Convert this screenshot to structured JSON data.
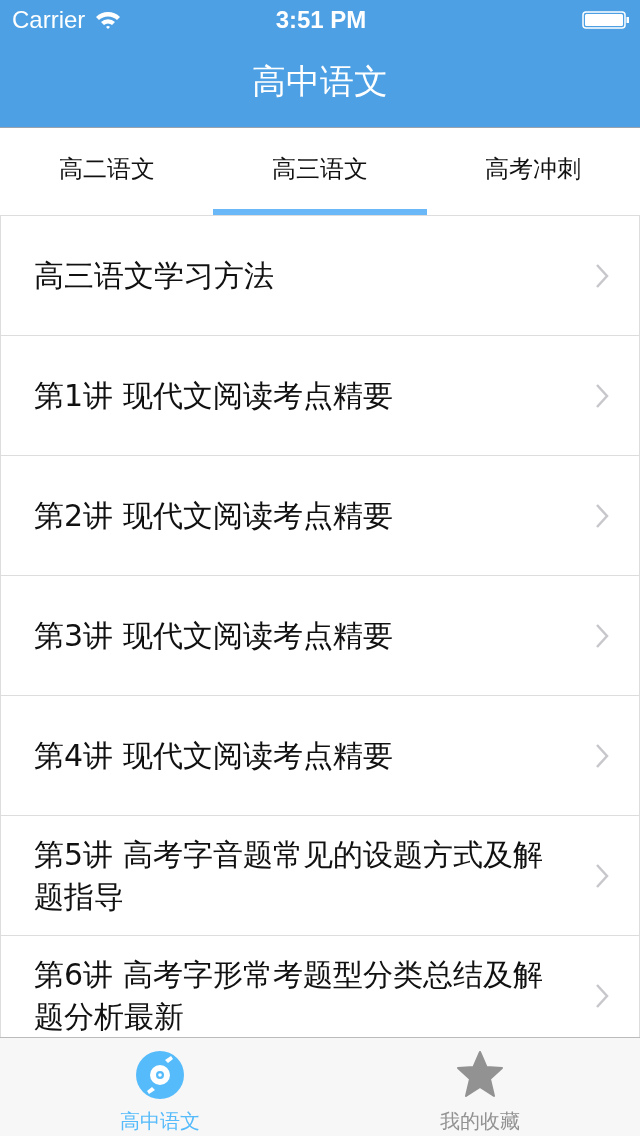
{
  "status_bar": {
    "carrier": "Carrier",
    "time": "3:51 PM"
  },
  "nav": {
    "title": "高中语文"
  },
  "tabs": [
    {
      "label": "高二语文",
      "selected": false
    },
    {
      "label": "高三语文",
      "selected": true
    },
    {
      "label": "高考冲刺",
      "selected": false
    }
  ],
  "list": {
    "items": [
      {
        "title": "高三语文学习方法"
      },
      {
        "title": "第1讲 现代文阅读考点精要"
      },
      {
        "title": "第2讲 现代文阅读考点精要"
      },
      {
        "title": "第3讲 现代文阅读考点精要"
      },
      {
        "title": "第4讲 现代文阅读考点精要"
      },
      {
        "title": "第5讲 高考字音题常见的设题方式及解题指导"
      },
      {
        "title": "第6讲 高考字形常考题型分类总结及解题分析最新"
      }
    ]
  },
  "tab_bar": {
    "items": [
      {
        "label": "高中语文",
        "kind": "disc",
        "selected": true
      },
      {
        "label": "我的收藏",
        "kind": "star",
        "selected": false
      }
    ]
  }
}
